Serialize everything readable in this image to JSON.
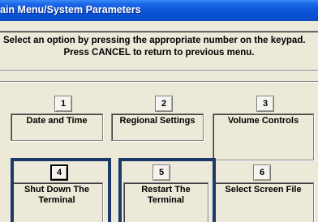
{
  "window": {
    "title": "ain Menu/System Parameters"
  },
  "instructions": {
    "line1": "Select an option by pressing the appropriate number on the keypad.",
    "line2": "Press CANCEL to return to previous menu."
  },
  "options": [
    {
      "key": "1",
      "label": "Date and Time"
    },
    {
      "key": "2",
      "label": "Regional Settings"
    },
    {
      "key": "3",
      "label": "Volume Controls"
    },
    {
      "key": "4",
      "label": "Shut Down The Terminal"
    },
    {
      "key": "5",
      "label": "Restart The Terminal"
    },
    {
      "key": "6",
      "label": "Select Screen File"
    }
  ],
  "colors": {
    "titlebar": "#0A55D8",
    "highlight": "#1B3A6B",
    "background": "#ECE9D8"
  }
}
